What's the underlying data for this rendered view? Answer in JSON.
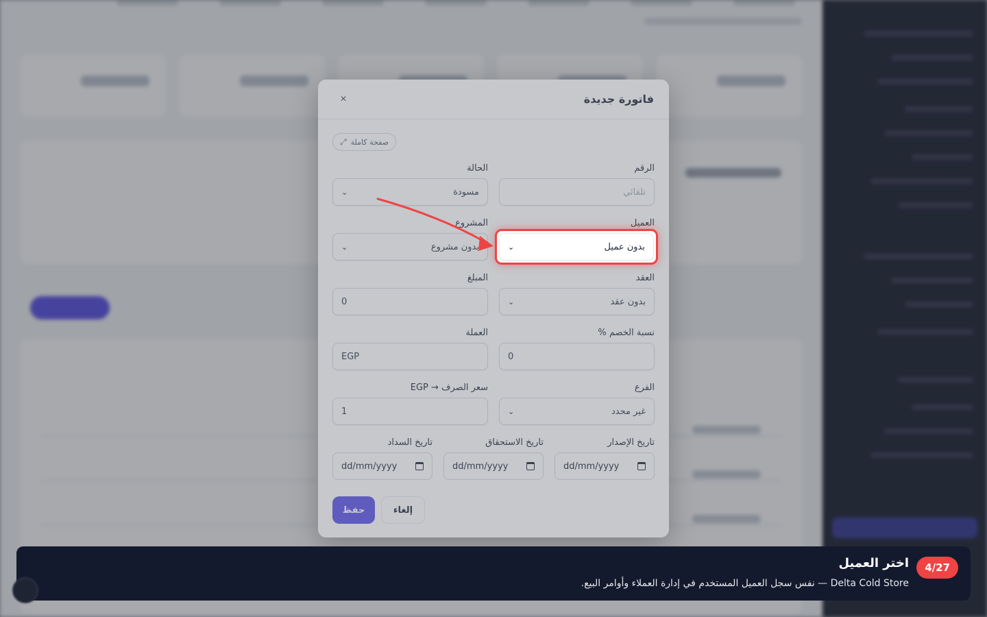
{
  "modal": {
    "title": "فاتورة جديدة",
    "close_icon": "×",
    "fullpage_label": "صفحة كاملة",
    "fields": {
      "number": {
        "label": "الرقم",
        "value": "تلقائي"
      },
      "status": {
        "label": "الحالة",
        "value": "مسودة"
      },
      "client": {
        "label": "العميل",
        "value": "بدون عميل"
      },
      "project": {
        "label": "المشروع",
        "value": "بدون مشروع"
      },
      "contract": {
        "label": "العقد",
        "value": "بدون عقد"
      },
      "amount": {
        "label": "المبلغ",
        "value": "0"
      },
      "discount": {
        "label": "نسبة الخصم %",
        "value": "0"
      },
      "currency": {
        "label": "العملة",
        "value": "EGP"
      },
      "branch": {
        "label": "الفرع",
        "value": "غير محدد"
      },
      "exchange_rate": {
        "label": "سعر الصرف → EGP",
        "value": "1"
      },
      "issue_date": {
        "label": "تاريخ الإصدار",
        "value": "dd/mm/yyyy"
      },
      "due_date": {
        "label": "تاريخ الاستحقاق",
        "value": "dd/mm/yyyy"
      },
      "payment_date": {
        "label": "تاريخ السداد",
        "value": "dd/mm/yyyy"
      }
    },
    "buttons": {
      "save": "حفظ",
      "cancel": "إلغاء"
    }
  },
  "tour": {
    "step": "4/27",
    "title": "اختر العميل",
    "description": "Delta Cold Store — نفس سجل العميل المستخدم في إدارة العملاء وأوامر البيع."
  },
  "colors": {
    "primary": "#4f46e5",
    "highlight": "#ef4444",
    "tour_bg": "#141a2e"
  }
}
